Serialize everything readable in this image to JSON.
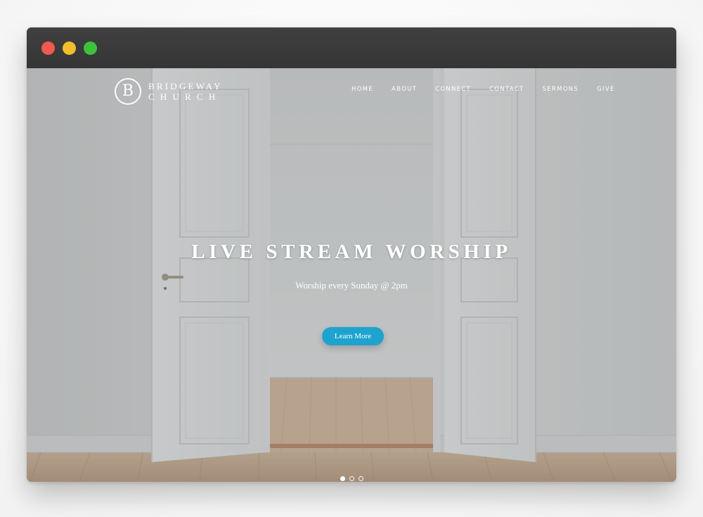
{
  "window_controls": {
    "close_color": "#f25a4f",
    "minimize_color": "#f2bd2b",
    "maximize_color": "#3ec23c"
  },
  "site": {
    "logo_mark": "B",
    "logo_line1": "BRIDGEWAY",
    "logo_line2": "CHURCH"
  },
  "nav": {
    "items": [
      {
        "label": "HOME"
      },
      {
        "label": "ABOUT"
      },
      {
        "label": "CONNECT"
      },
      {
        "label": "CONTACT"
      },
      {
        "label": "SERMONS"
      },
      {
        "label": "GIVE"
      }
    ]
  },
  "hero": {
    "title": "LIVE STREAM WORSHIP",
    "subtitle": "Worship every Sunday @ 2pm",
    "cta_label": "Learn More",
    "cta_color": "#1ea3cf",
    "slides_total": 3,
    "active_slide": 1
  },
  "background_image": {
    "icon": "open-double-doors-photo"
  }
}
